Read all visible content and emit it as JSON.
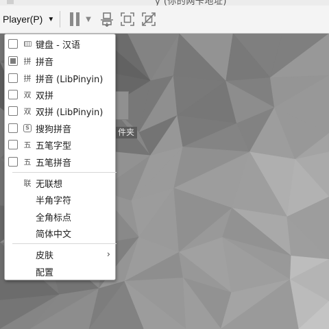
{
  "title_strip": {
    "text": "y   (你的网卡地址)"
  },
  "toolbar": {
    "player_menu": "Player(P)",
    "icons": [
      "pause-icon",
      "dropdown-caret-icon",
      "send-keys-icon",
      "fit-window-icon",
      "unity-mode-icon"
    ]
  },
  "desktop": {
    "folder_label": "件夹"
  },
  "menu": {
    "input_methods": [
      {
        "label": "键盘 - 汉语",
        "icon": "keyboard-icon",
        "glyph": "",
        "checked": false
      },
      {
        "label": "拼音",
        "icon": "pinyin-icon",
        "glyph": "拼",
        "checked": true
      },
      {
        "label": "拼音 (LibPinyin)",
        "icon": "pinyin-icon",
        "glyph": "拼",
        "checked": false
      },
      {
        "label": "双拼",
        "icon": "shuangpin-icon",
        "glyph": "双",
        "checked": false
      },
      {
        "label": "双拼 (LibPinyin)",
        "icon": "shuangpin-icon",
        "glyph": "双",
        "checked": false
      },
      {
        "label": "搜狗拼音",
        "icon": "sogou-icon",
        "glyph": "S",
        "checked": false
      },
      {
        "label": "五笔字型",
        "icon": "wubi-icon",
        "glyph": "五",
        "checked": false
      },
      {
        "label": "五笔拼音",
        "icon": "wubi-icon",
        "glyph": "五",
        "checked": false
      }
    ],
    "options": [
      {
        "label": "无联想",
        "icon": "association-icon",
        "glyph": "联"
      },
      {
        "label": "半角字符",
        "icon": "",
        "glyph": ""
      },
      {
        "label": "全角标点",
        "icon": "",
        "glyph": ""
      },
      {
        "label": "简体中文",
        "icon": "",
        "glyph": ""
      }
    ],
    "skin": {
      "label": "皮肤",
      "arrow": "›"
    },
    "config": {
      "label": "配置"
    }
  }
}
